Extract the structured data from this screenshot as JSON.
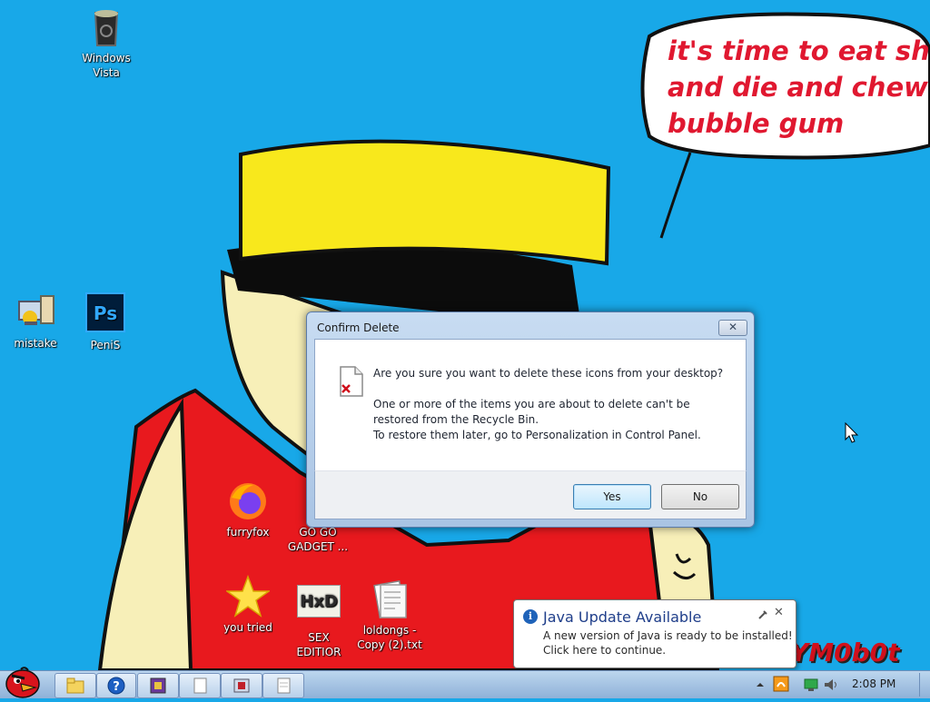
{
  "desktop": {
    "icons": [
      {
        "label": "Windows\nVista",
        "icon": "recycle-bin-icon"
      },
      {
        "label": "mistake",
        "icon": "computer-network-icon"
      },
      {
        "label": "PeniS",
        "icon": "photoshop-icon",
        "glyph": "Ps"
      },
      {
        "label": "furryfox",
        "icon": "firefox-icon"
      },
      {
        "label": "GO GO\nGADGET ...",
        "icon": "package-icon"
      },
      {
        "label": "you tried",
        "icon": "star-icon"
      },
      {
        "label": "SEX\nEDITIOR",
        "icon": "hex-editor-icon",
        "glyph": "HxD"
      },
      {
        "label": "loldongs -\nCopy (2).txt",
        "icon": "text-file-icon"
      }
    ]
  },
  "wallpaper": {
    "speech_lines": [
      "it's time to eat shit",
      "and die and chew",
      "bubble gum"
    ],
    "signature": "YM0b0t"
  },
  "dialog": {
    "title": "Confirm Delete",
    "close_glyph": "✕",
    "question": "Are you sure you want to delete these icons from your desktop?",
    "detail_line1": "One or more of the items you are about to delete can't be",
    "detail_line2": "restored from the Recycle Bin.",
    "detail_line3": "To restore them later, go to Personalization in Control Panel.",
    "yes_label": "Yes",
    "no_label": "No"
  },
  "balloon": {
    "title": "Java Update Available",
    "line1": "A new version of Java is ready to be installed!",
    "line2": "Click here to continue.",
    "info_glyph": "i",
    "close_glyph": "✕"
  },
  "taskbar": {
    "clock": "2:08 PM",
    "colors": {
      "accent": "#18a8e8",
      "hat": "#f8e81c",
      "shirt": "#e8191e",
      "skin": "#f7efb8",
      "speech": "#e01830"
    }
  }
}
